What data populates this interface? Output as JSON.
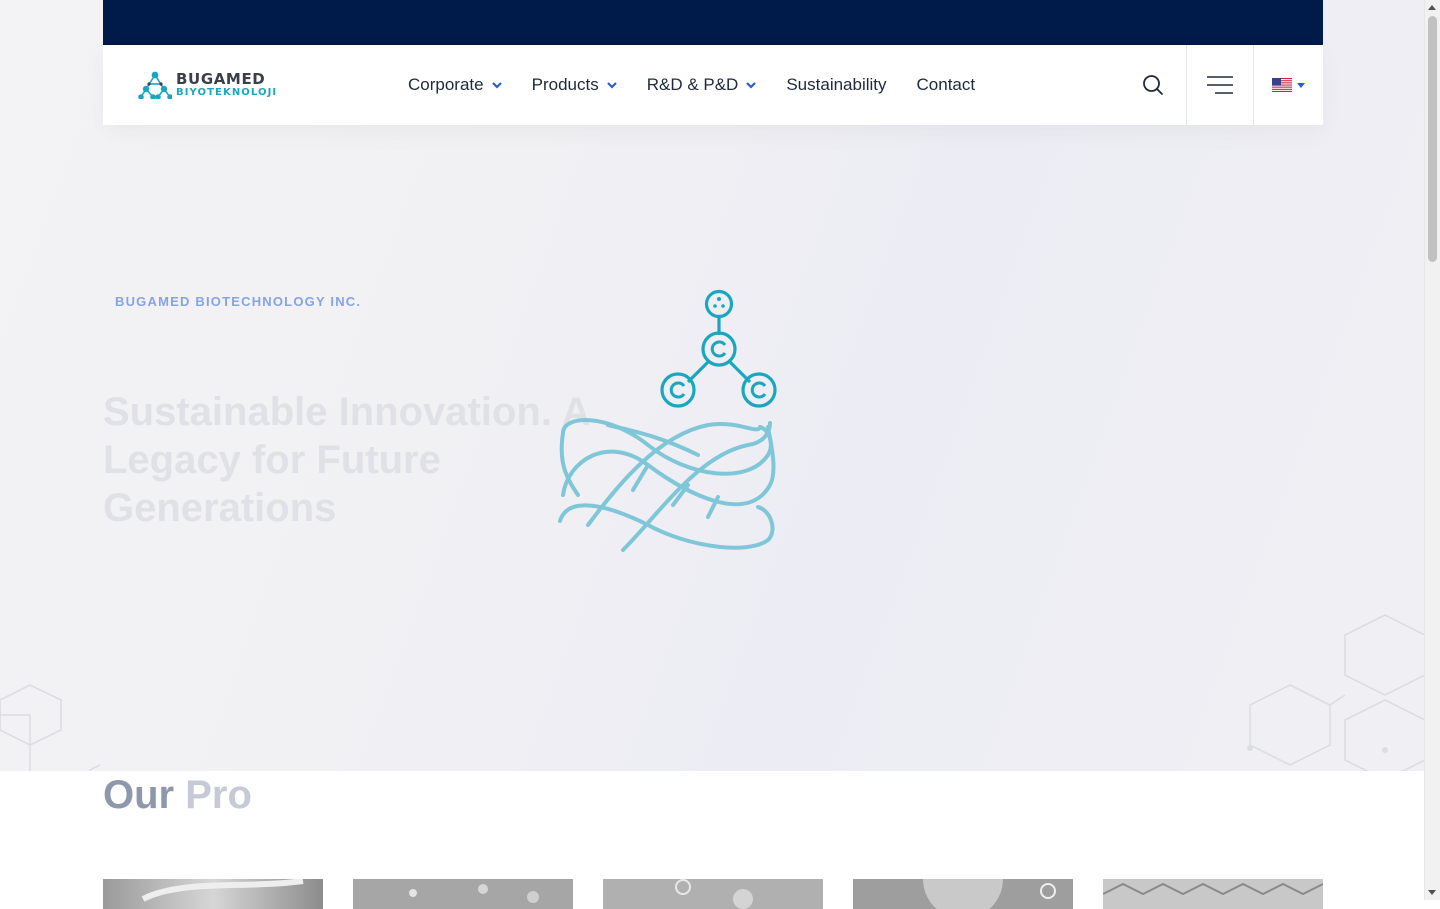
{
  "brand": {
    "name_line1": "BUGAMED",
    "name_line2": "BIYOTEKNOLOJI",
    "accent": "#1aa6bf"
  },
  "nav": {
    "items": [
      {
        "label": "Corporate",
        "has_dropdown": true
      },
      {
        "label": "Products",
        "has_dropdown": true
      },
      {
        "label": "R&D & P&D",
        "has_dropdown": true
      },
      {
        "label": "Sustainability",
        "has_dropdown": false
      },
      {
        "label": "Contact",
        "has_dropdown": false
      }
    ],
    "actions": {
      "search_icon": "search-icon",
      "menu_icon": "hamburger-menu-icon",
      "language_icon": "us-flag-icon"
    }
  },
  "hero": {
    "eyebrow": "BUGAMED BIOTECHNOLOGY INC.",
    "title": "Sustainable Innovation. A Legacy for Future Generations"
  },
  "products_section": {
    "title_dark": "Our ",
    "title_light": "Pro"
  },
  "colors": {
    "topbar": "#001a4a",
    "nav_chevron": "#2c5bd6",
    "illustration": "#1aa6bf"
  }
}
